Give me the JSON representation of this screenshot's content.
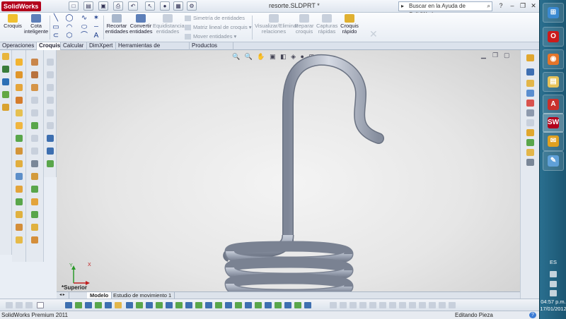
{
  "app": {
    "logo": "SolidWorks",
    "document_title": "resorte.SLDPRT *",
    "help_search_placeholder": "Buscar en la Ayuda de SolidWorks"
  },
  "window_controls": {
    "minimize": "–",
    "restore": "❐",
    "close": "✕"
  },
  "command_manager": {
    "croquis": "Croquis",
    "cota_line1": "Cota",
    "cota_line2": "inteligente",
    "recortar_line1": "Recortar",
    "recortar_line2": "entidades",
    "convertir_line1": "Convertir",
    "convertir_line2": "entidades",
    "equidistanciar_line1": "Equidistanciar",
    "equidistanciar_line2": "entidades",
    "simetria": "Simetría de entidades",
    "matriz": "Matriz lineal de croquis",
    "mover": "Mover entidades",
    "visualizar_line1": "Visualizar/Eliminar",
    "visualizar_line2": "relaciones",
    "reparar_line1": "Reparar",
    "reparar_line2": "croquis",
    "capturas_line1": "Capturas",
    "capturas_line2": "rápidas",
    "croquis_rapido_line1": "Croquis",
    "croquis_rapido_line2": "rápido"
  },
  "tabs": [
    {
      "label": "Operaciones"
    },
    {
      "label": "Croquis",
      "active": true
    },
    {
      "label": "Calcular"
    },
    {
      "label": "DimXpert"
    },
    {
      "label": "Herramientas de renderizado"
    },
    {
      "label": "Productos Office"
    }
  ],
  "viewport": {
    "view_label": "*Superior",
    "triad_x": "X",
    "triad_y": "Y"
  },
  "model_tabs": [
    {
      "label": "Modelo",
      "active": true
    },
    {
      "label": "Estudio de movimiento 1"
    }
  ],
  "status": {
    "product": "SolidWorks Premium 2011",
    "mode": "Editando Pieza",
    "help": "?"
  },
  "taskbar": {
    "language": "ES",
    "time": "04:57 p.m.",
    "date": "17/01/2012",
    "apps": [
      "opera",
      "firefox",
      "explorer",
      "autocad",
      "solidworks",
      "outlook",
      "paint"
    ]
  },
  "colors": {
    "spring": "#8e96a6",
    "spring_highlight": "#d9dde6",
    "brand": "#b3001b",
    "taskbar": "#1f607d"
  }
}
